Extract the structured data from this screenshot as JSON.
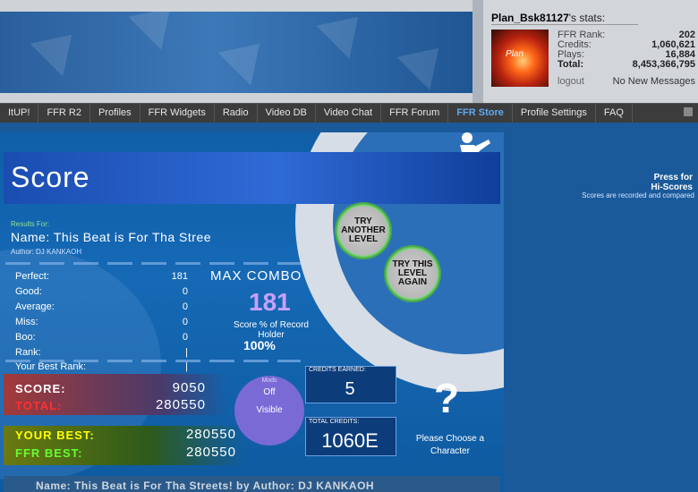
{
  "header": {
    "stats_user": "Plan_Bsk81127",
    "stats_suffix": "'s stats:",
    "avatar_text": "Plan",
    "stats": [
      {
        "label": "FFR Rank:",
        "value": "202"
      },
      {
        "label": "Credits:",
        "value": "1,060,621"
      },
      {
        "label": "Plays:",
        "value": "16,884"
      },
      {
        "label": "Total:",
        "value": "8,453,366,795"
      }
    ],
    "logout": "logout",
    "no_messages": "No New Messages"
  },
  "nav": {
    "items": [
      "ItUP!",
      "FFR R2",
      "Profiles",
      "FFR Widgets",
      "Radio",
      "Video DB",
      "Video Chat",
      "FFR Forum",
      "FFR Store",
      "Profile Settings",
      "FAQ"
    ],
    "active": "FFR Store"
  },
  "game": {
    "title": "Score",
    "press_for": "Press for",
    "hi_scores": "Hi-Scores",
    "scores_recorded": "Scores are recorded and compared",
    "results_for": "Results For:",
    "song_name": "Name: This Beat is For Tha Stree",
    "author": "Author: DJ KANKAOH",
    "stats": [
      {
        "label": "Perfect:",
        "value": "181"
      },
      {
        "label": "Good:",
        "value": "0"
      },
      {
        "label": "Average:",
        "value": "0"
      },
      {
        "label": "Miss:",
        "value": "0"
      },
      {
        "label": "Boo:",
        "value": "0"
      },
      {
        "label": "Rank:",
        "value": "|"
      },
      {
        "label": "Your Best Rank:",
        "value": "|"
      }
    ],
    "max_combo_label": "MAX COMBO",
    "max_combo_value": "181",
    "score_pct_label": "Score % of Record Holder",
    "score_pct_value": "100%",
    "try_another": "TRY ANOTHER LEVEL",
    "try_again": "TRY THIS LEVEL AGAIN",
    "score_label": "SCORE:",
    "score_value": "9050",
    "total_label": "TOTAL:",
    "total_value": "280550",
    "your_best_label": "YOUR BEST:",
    "your_best_value": "280550",
    "ffr_best_label": "FFR BEST:",
    "ffr_best_value": "280550",
    "mods_label": "Mods",
    "mods_off": "Off",
    "mods_visible": "Visible",
    "credits_earned_label": "CREDITS EARNED:",
    "credits_earned_value": "5",
    "total_credits_label": "TOTAL CREDITS:",
    "total_credits_value": "1060E",
    "question": "?",
    "choose_character": "Please Choose a Character",
    "footer": "Name: This Beat is For Tha Streets! by Author: DJ KANKAOH"
  },
  "colors": {
    "score_label": "#ffffff",
    "total_label": "#ff3030",
    "your_best_label": "#ffff00",
    "ffr_best_label": "#66ff33",
    "nav_active": "#5da9f0"
  }
}
